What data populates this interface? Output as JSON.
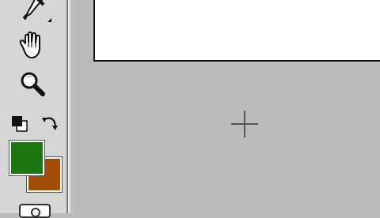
{
  "toolbar": {
    "tools": [
      {
        "icon": "eyedropper-icon",
        "has_submenu": true
      },
      {
        "icon": "hand-icon",
        "has_submenu": false
      },
      {
        "icon": "zoom-icon",
        "has_submenu": false
      },
      {
        "icon": "default-colors-icon",
        "has_submenu": false
      },
      {
        "icon": "swap-colors-icon",
        "has_submenu": false
      },
      {
        "icon": "quick-mask-icon",
        "has_submenu": false
      }
    ]
  },
  "colors": {
    "foreground": "#1e7612",
    "background": "#a04e04",
    "workspace": "#bbbbbb",
    "toolbar": "#d6d6d6",
    "document": "#ffffff"
  },
  "cursor": {
    "icon": "crosshair-cursor-icon"
  }
}
